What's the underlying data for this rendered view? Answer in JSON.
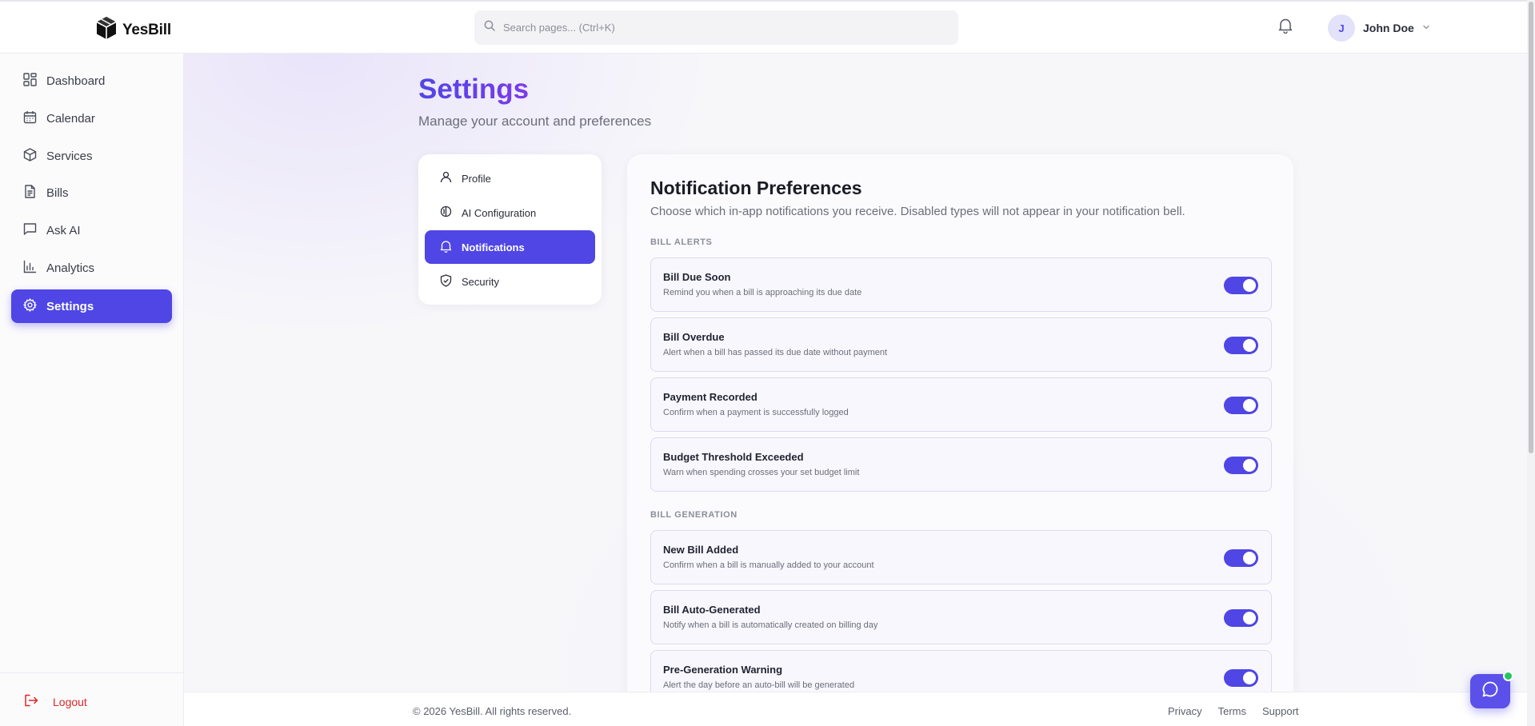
{
  "app": {
    "name": "YesBill"
  },
  "header": {
    "search_placeholder": "Search pages... (Ctrl+K)",
    "user": {
      "initial": "J",
      "name": "John Doe"
    }
  },
  "sidebar": {
    "items": [
      {
        "label": "Dashboard",
        "icon": "dashboard-icon"
      },
      {
        "label": "Calendar",
        "icon": "calendar-icon"
      },
      {
        "label": "Services",
        "icon": "package-icon"
      },
      {
        "label": "Bills",
        "icon": "file-icon"
      },
      {
        "label": "Ask AI",
        "icon": "chat-icon"
      },
      {
        "label": "Analytics",
        "icon": "bar-chart-icon"
      },
      {
        "label": "Settings",
        "icon": "gear-icon",
        "active": true
      }
    ],
    "logout_label": "Logout"
  },
  "page": {
    "title": "Settings",
    "subtitle": "Manage your account and preferences"
  },
  "settings_tabs": [
    {
      "label": "Profile",
      "icon": "user-icon"
    },
    {
      "label": "AI Configuration",
      "icon": "brain-icon"
    },
    {
      "label": "Notifications",
      "icon": "bell-icon",
      "active": true
    },
    {
      "label": "Security",
      "icon": "shield-icon"
    }
  ],
  "notifications": {
    "title": "Notification Preferences",
    "description": "Choose which in-app notifications you receive. Disabled types will not appear in your notification bell.",
    "sections": [
      {
        "label": "BILL ALERTS",
        "items": [
          {
            "title": "Bill Due Soon",
            "description": "Remind you when a bill is approaching its due date",
            "enabled": true
          },
          {
            "title": "Bill Overdue",
            "description": "Alert when a bill has passed its due date without payment",
            "enabled": true
          },
          {
            "title": "Payment Recorded",
            "description": "Confirm when a payment is successfully logged",
            "enabled": true
          },
          {
            "title": "Budget Threshold Exceeded",
            "description": "Warn when spending crosses your set budget limit",
            "enabled": true
          }
        ]
      },
      {
        "label": "BILL GENERATION",
        "items": [
          {
            "title": "New Bill Added",
            "description": "Confirm when a bill is manually added to your account",
            "enabled": true
          },
          {
            "title": "Bill Auto-Generated",
            "description": "Notify when a bill is automatically created on billing day",
            "enabled": true
          },
          {
            "title": "Pre-Generation Warning",
            "description": "Alert the day before an auto-bill will be generated",
            "enabled": true
          }
        ]
      }
    ]
  },
  "footer": {
    "copyright": "© 2026 YesBill. All rights reserved.",
    "links": [
      "Privacy",
      "Terms",
      "Support"
    ]
  },
  "colors": {
    "accent": "#4f46e5",
    "logout": "#dc2626",
    "online": "#22c55e"
  }
}
